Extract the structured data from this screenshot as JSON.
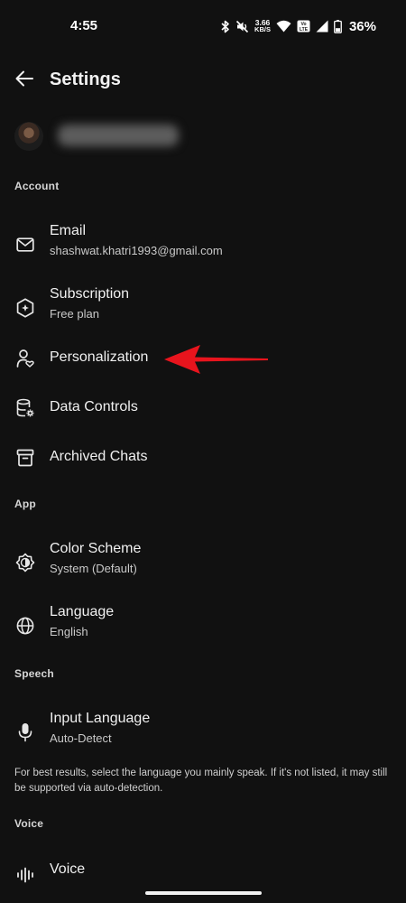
{
  "status_bar": {
    "time": "4:55",
    "net_speed_value": "3.66",
    "net_speed_unit": "KB/S",
    "volte_label": "Vo LTE",
    "battery_percent": "36%",
    "icons": [
      "bluetooth-icon",
      "mute-icon",
      "wifi-icon",
      "volte-icon",
      "signal-icon",
      "battery-icon"
    ]
  },
  "header": {
    "title": "Settings",
    "back_icon": "arrow-left-icon"
  },
  "profile": {
    "avatar": "user-avatar",
    "name_blurred": true
  },
  "sections": {
    "account": "Account",
    "app": "App",
    "speech": "Speech",
    "voice": "Voice"
  },
  "account": {
    "email": {
      "title": "Email",
      "value": "shashwat.khatri1993@gmail.com",
      "icon": "mail-icon"
    },
    "subscription": {
      "title": "Subscription",
      "value": "Free plan",
      "icon": "subscription-icon"
    },
    "personalization": {
      "title": "Personalization",
      "icon": "personalization-icon"
    },
    "data_controls": {
      "title": "Data Controls",
      "icon": "data-controls-icon"
    },
    "archived_chats": {
      "title": "Archived Chats",
      "icon": "archive-icon"
    }
  },
  "app": {
    "color_scheme": {
      "title": "Color Scheme",
      "value": "System (Default)",
      "icon": "color-scheme-icon"
    },
    "language": {
      "title": "Language",
      "value": "English",
      "icon": "globe-icon"
    }
  },
  "speech": {
    "input_language": {
      "title": "Input Language",
      "value": "Auto-Detect",
      "icon": "microphone-icon"
    },
    "helper": "For best results, select the language you mainly speak. If it's not listed, it may still be supported via auto-detection."
  },
  "voice": {
    "voice_row": {
      "title": "Voice",
      "icon": "waveform-icon"
    }
  },
  "annotation": {
    "color": "#e8141d"
  },
  "colors": {
    "background": "#111111",
    "text_primary": "#f0f0f0",
    "text_secondary": "#c9c9c9"
  }
}
